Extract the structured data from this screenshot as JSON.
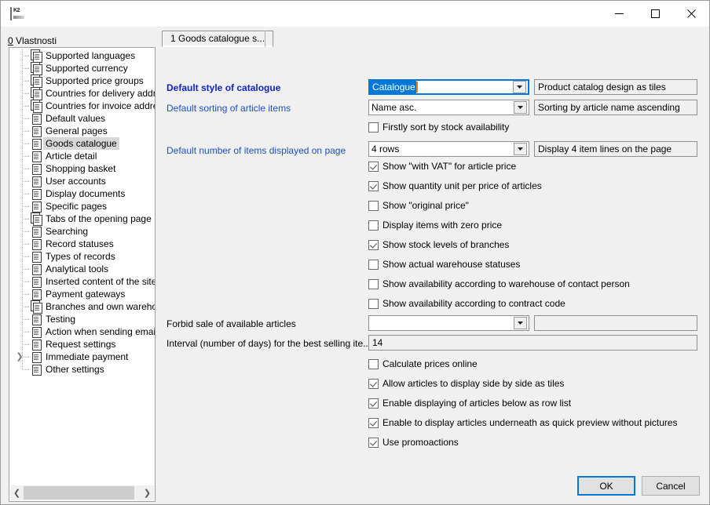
{
  "window": {
    "app_icon": "k2-logo-icon",
    "minimize_label": "Minimize",
    "maximize_label": "Maximize",
    "close_label": "Close"
  },
  "left_pane": {
    "label_accel": "0",
    "label_text": " Vlastnosti",
    "tree_items": [
      {
        "label": "Supported languages",
        "icon": "multi-page-icon",
        "selected": false,
        "expandable": false
      },
      {
        "label": "Supported currency",
        "icon": "multi-page-icon",
        "selected": false,
        "expandable": false
      },
      {
        "label": "Supported price groups",
        "icon": "multi-page-icon",
        "selected": false,
        "expandable": false
      },
      {
        "label": "Countries for delivery address",
        "icon": "multi-page-icon",
        "selected": false,
        "expandable": false
      },
      {
        "label": "Countries for invoice addresses",
        "icon": "multi-page-icon",
        "selected": false,
        "expandable": false
      },
      {
        "label": "Default values",
        "icon": "page-icon",
        "selected": false,
        "expandable": false
      },
      {
        "label": "General pages",
        "icon": "page-icon",
        "selected": false,
        "expandable": false
      },
      {
        "label": "Goods catalogue",
        "icon": "page-icon",
        "selected": true,
        "expandable": false
      },
      {
        "label": "Article detail",
        "icon": "page-icon",
        "selected": false,
        "expandable": false
      },
      {
        "label": "Shopping basket",
        "icon": "page-icon",
        "selected": false,
        "expandable": false
      },
      {
        "label": "User accounts",
        "icon": "page-icon",
        "selected": false,
        "expandable": false
      },
      {
        "label": "Display documents",
        "icon": "page-icon",
        "selected": false,
        "expandable": false
      },
      {
        "label": "Specific pages",
        "icon": "page-icon",
        "selected": false,
        "expandable": false
      },
      {
        "label": "Tabs of the opening page",
        "icon": "multi-page-icon",
        "selected": false,
        "expandable": false
      },
      {
        "label": "Searching",
        "icon": "page-icon",
        "selected": false,
        "expandable": false
      },
      {
        "label": "Record statuses",
        "icon": "page-icon",
        "selected": false,
        "expandable": false
      },
      {
        "label": "Types of records",
        "icon": "page-icon",
        "selected": false,
        "expandable": false
      },
      {
        "label": "Analytical tools",
        "icon": "page-icon",
        "selected": false,
        "expandable": false
      },
      {
        "label": "Inserted content of the sites",
        "icon": "page-icon",
        "selected": false,
        "expandable": false
      },
      {
        "label": "Payment gateways",
        "icon": "page-icon",
        "selected": false,
        "expandable": false
      },
      {
        "label": "Branches and own warehouses",
        "icon": "multi-page-icon",
        "selected": false,
        "expandable": false
      },
      {
        "label": "Testing",
        "icon": "page-icon",
        "selected": false,
        "expandable": false
      },
      {
        "label": "Action when sending email",
        "icon": "page-icon",
        "selected": false,
        "expandable": false
      },
      {
        "label": "Request settings",
        "icon": "page-icon",
        "selected": false,
        "expandable": false
      },
      {
        "label": "Immediate payment",
        "icon": "page-icon",
        "selected": false,
        "expandable": true
      },
      {
        "label": "Other settings",
        "icon": "page-icon",
        "selected": false,
        "expandable": false
      }
    ],
    "scroll_left_icon": "chevron-left-icon",
    "scroll_right_icon": "chevron-right-icon"
  },
  "tabs": [
    {
      "label": "1 Goods catalogue s...",
      "active": true
    }
  ],
  "form": {
    "rows": {
      "default_style": {
        "label": "Default style of catalogue",
        "value": "Catalogue",
        "description": "Product catalog design as tiles"
      },
      "default_sorting": {
        "label": "Default sorting of article items",
        "value": "Name asc.",
        "description": "Sorting by article name ascending"
      },
      "firstly_sort": {
        "label": "Firstly sort by stock availability",
        "checked": false
      },
      "items_per_page": {
        "label": "Default number of items displayed on page",
        "value": "4 rows",
        "description": "Display 4 item lines on the page"
      },
      "forbid_sale": {
        "label": "Forbid sale of available articles",
        "value": "",
        "description": ""
      },
      "interval_days": {
        "label": "Interval (number of days) for the best selling ite...",
        "value": "14"
      }
    },
    "checkboxes_mid": [
      {
        "label": "Show \"with VAT\" for article price",
        "checked": true
      },
      {
        "label": "Show quantity unit per price of articles",
        "checked": true
      },
      {
        "label": "Show \"original price\"",
        "checked": false
      },
      {
        "label": "Display items with zero price",
        "checked": false
      },
      {
        "label": "Show stock levels of branches",
        "checked": true
      },
      {
        "label": "Show actual warehouse statuses",
        "checked": false
      },
      {
        "label": "Show availability according to warehouse of contact person",
        "checked": false
      },
      {
        "label": "Show availability according to contract code",
        "checked": false
      }
    ],
    "checkboxes_bottom": [
      {
        "label": "Calculate prices online",
        "checked": false
      },
      {
        "label": "Allow articles to display side by side as tiles",
        "checked": true
      },
      {
        "label": "Enable displaying of articles below as row list",
        "checked": true
      },
      {
        "label": "Enable to display articles underneath as quick preview without pictures",
        "checked": true
      },
      {
        "label": "Use promoactions",
        "checked": true
      }
    ]
  },
  "footer": {
    "ok_label": "OK",
    "cancel_label": "Cancel"
  },
  "colors": {
    "accent": "#0078d7",
    "label_blue": "#1b4fc4",
    "window_bg": "#f0f0f0",
    "selection": "#0078d7"
  }
}
